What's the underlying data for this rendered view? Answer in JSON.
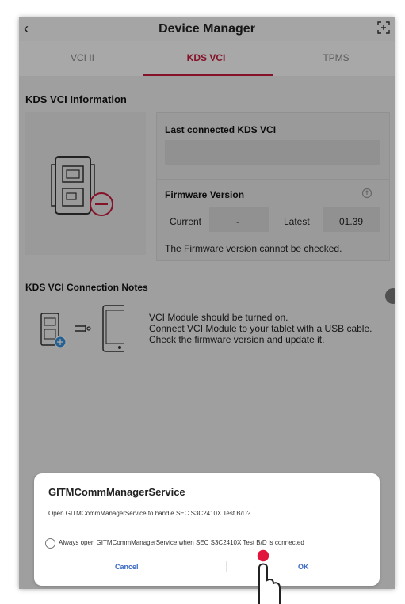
{
  "header": {
    "title": "Device Manager",
    "back_icon": "chevron-left-icon",
    "expand_icon": "fullscreen-icon"
  },
  "tabs": [
    {
      "label": "VCI II",
      "active": false
    },
    {
      "label": "KDS VCI",
      "active": true
    },
    {
      "label": "TPMS",
      "active": false
    }
  ],
  "info": {
    "title": "KDS VCI Information",
    "last_connected_label": "Last connected KDS VCI",
    "last_connected_value": "",
    "firmware_label": "Firmware Version",
    "current_label": "Current",
    "current_value": "-",
    "latest_label": "Latest",
    "latest_value": "01.39",
    "status_text": "The Firmware version cannot be checked."
  },
  "notes": {
    "title": "KDS VCI Connection Notes",
    "lines": [
      "VCI Module should be turned on.",
      "Connect VCI Module to your tablet with a USB cable.",
      "Check the firmware version and update it."
    ]
  },
  "dialog": {
    "title": "GITMCommManagerService",
    "message": "Open GITMCommManagerService to handle SEC S3C2410X Test B/D?",
    "checkbox_label": "Always open GITMCommManagerService when SEC S3C2410X Test B/D is connected",
    "cancel_label": "Cancel",
    "ok_label": "OK"
  },
  "colors": {
    "accent": "#c51b3c",
    "dialog_button": "#3a68c4"
  }
}
